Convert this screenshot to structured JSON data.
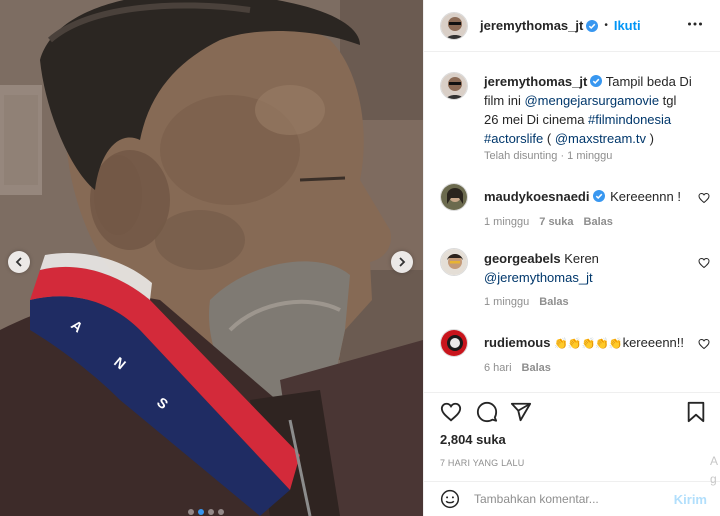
{
  "media": {
    "carousel_dots": 4,
    "active_dot": 1,
    "prev_icon": "chevron-left-icon",
    "next_icon": "chevron-right-icon",
    "jacket_letters": [
      "A",
      "N",
      "S"
    ]
  },
  "header": {
    "username": "jeremythomas_jt",
    "separator": "•",
    "follow_label": "Ikuti",
    "more_icon": "more-horizontal-icon"
  },
  "caption": {
    "username": "jeremythomas_jt",
    "text_1": "Tampil beda Di film ini ",
    "mention_1": "@mengejarsurgamovie",
    "text_2": " tgl 26 mei Di cinema ",
    "hashtag_1": "#filmindonesia",
    "hashtag_2": "#actorslife",
    "text_3": " ( ",
    "mention_2": "@maxstream.tv",
    "text_4": " )",
    "meta": "Telah disunting · 1 minggu"
  },
  "comments": [
    {
      "username": "maudykoesnaedi",
      "text": "Kereeennn !",
      "time": "1 minggu",
      "likes": "7 suka",
      "reply": "Balas"
    },
    {
      "username": "georgeabels",
      "text": "Keren",
      "mention": "@jeremythomas_jt",
      "time": "1 minggu",
      "reply": "Balas"
    },
    {
      "username": "rudiemous",
      "emojis": "👏👏👏👏👏",
      "text": "kereeenn!!",
      "time": "6 hari",
      "reply": "Balas"
    }
  ],
  "actions": {
    "like_icon": "heart-icon",
    "comment_icon": "comment-icon",
    "share_icon": "send-icon",
    "save_icon": "bookmark-icon"
  },
  "likes": "2,804 suka",
  "date": "7 HARI YANG LALU",
  "add_comment": {
    "placeholder": "Tambahkan komentar...",
    "post_label": "Kirim",
    "emoji_icon": "smiley-icon"
  },
  "edge_text": "A\ng",
  "colors": {
    "verified": "#3897f0",
    "link": "#00376b",
    "follow": "#0095f6",
    "muted": "#8e8e8e"
  }
}
